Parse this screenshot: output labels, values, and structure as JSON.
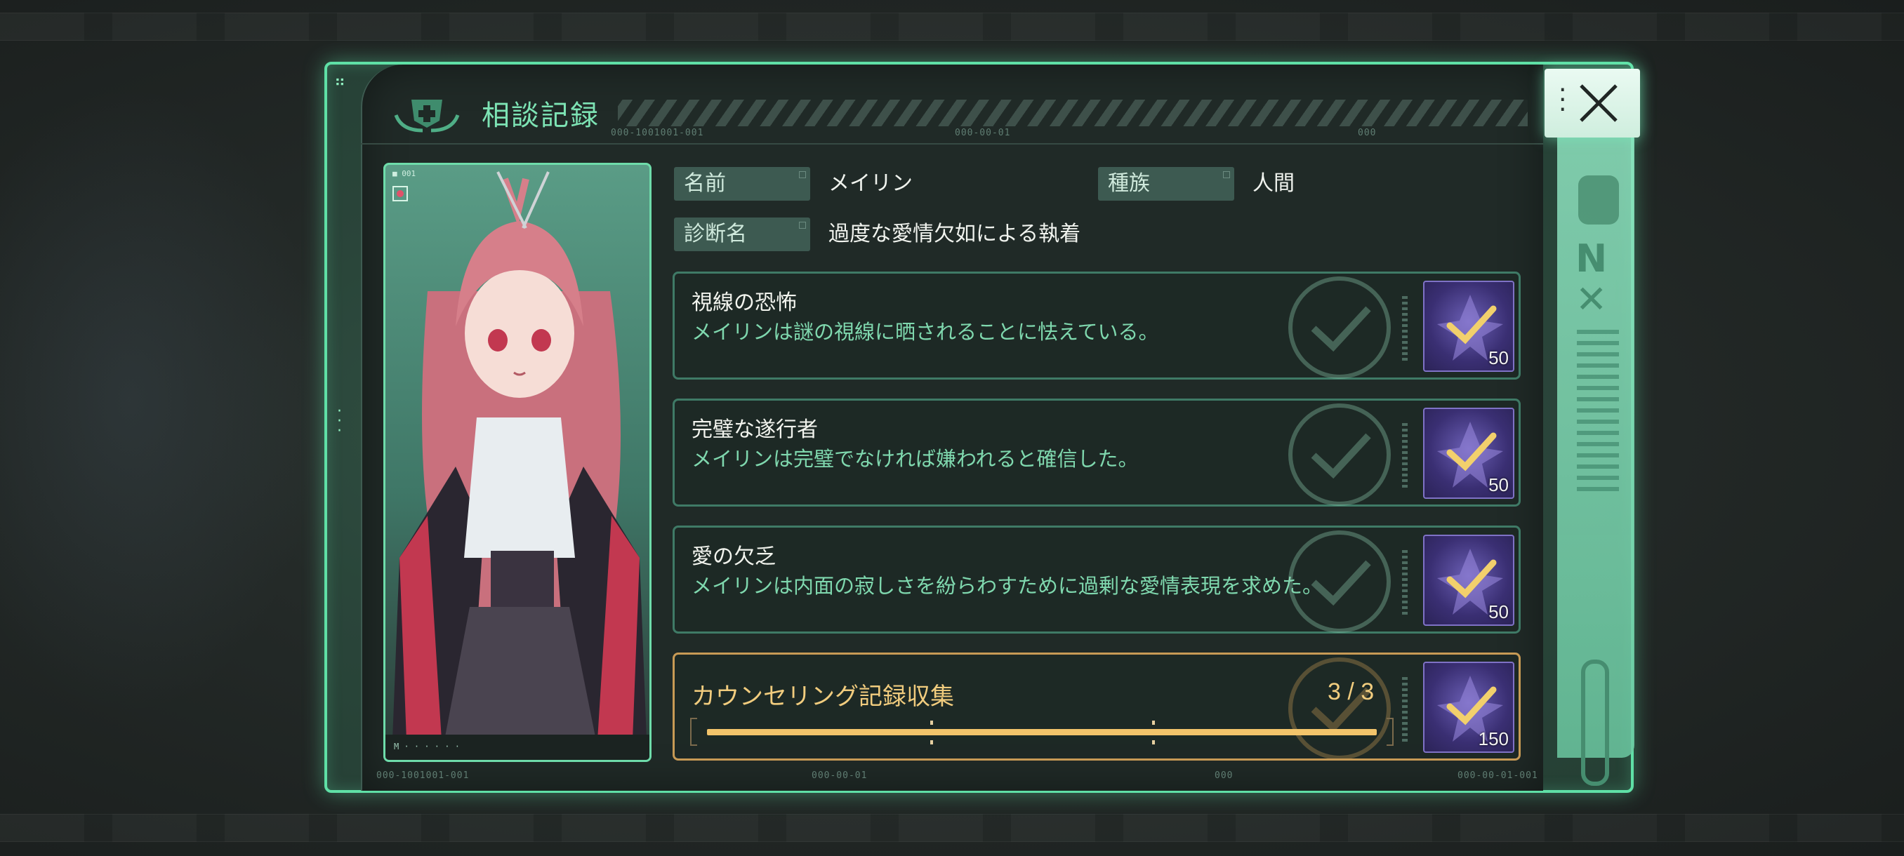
{
  "window": {
    "title": "相談記録",
    "codes": [
      "000-1001001-001",
      "000-00-01",
      "000"
    ],
    "footer_codes": [
      "000-1001001-001",
      "000-00-01",
      "000",
      "000-00-01-001"
    ]
  },
  "profile": {
    "name_label": "名前",
    "name_value": "メイリン",
    "race_label": "種族",
    "race_value": "人間",
    "diagnosis_label": "診断名",
    "diagnosis_value": "過度な愛情欠如による執着"
  },
  "records": [
    {
      "title": "視線の恐怖",
      "description": "メイリンは謎の視線に晒されることに怯えている。",
      "reward_count": "50",
      "completed": true
    },
    {
      "title": "完璧な遂行者",
      "description": "メイリンは完璧でなければ嫌われると確信した。",
      "reward_count": "50",
      "completed": true
    },
    {
      "title": "愛の欠乏",
      "description": "メイリンは内面の寂しさを紛らわすために過剰な愛情表現を求めた。",
      "reward_count": "50",
      "completed": true
    }
  ],
  "collection": {
    "title": "カウンセリング記録収集",
    "progress_text": "3 / 3",
    "progress_current": 3,
    "progress_total": 3,
    "reward_count": "150"
  },
  "colors": {
    "accent_green": "#5fe0a6",
    "record_desc": "#7fd8ae",
    "gold": "#f1cc7e",
    "reward_purple": "#3a2f73"
  },
  "icons": [
    "close-icon",
    "kebab-menu-icon",
    "checkmark-icon",
    "reward-item-icon",
    "header-emblem-icon"
  ]
}
